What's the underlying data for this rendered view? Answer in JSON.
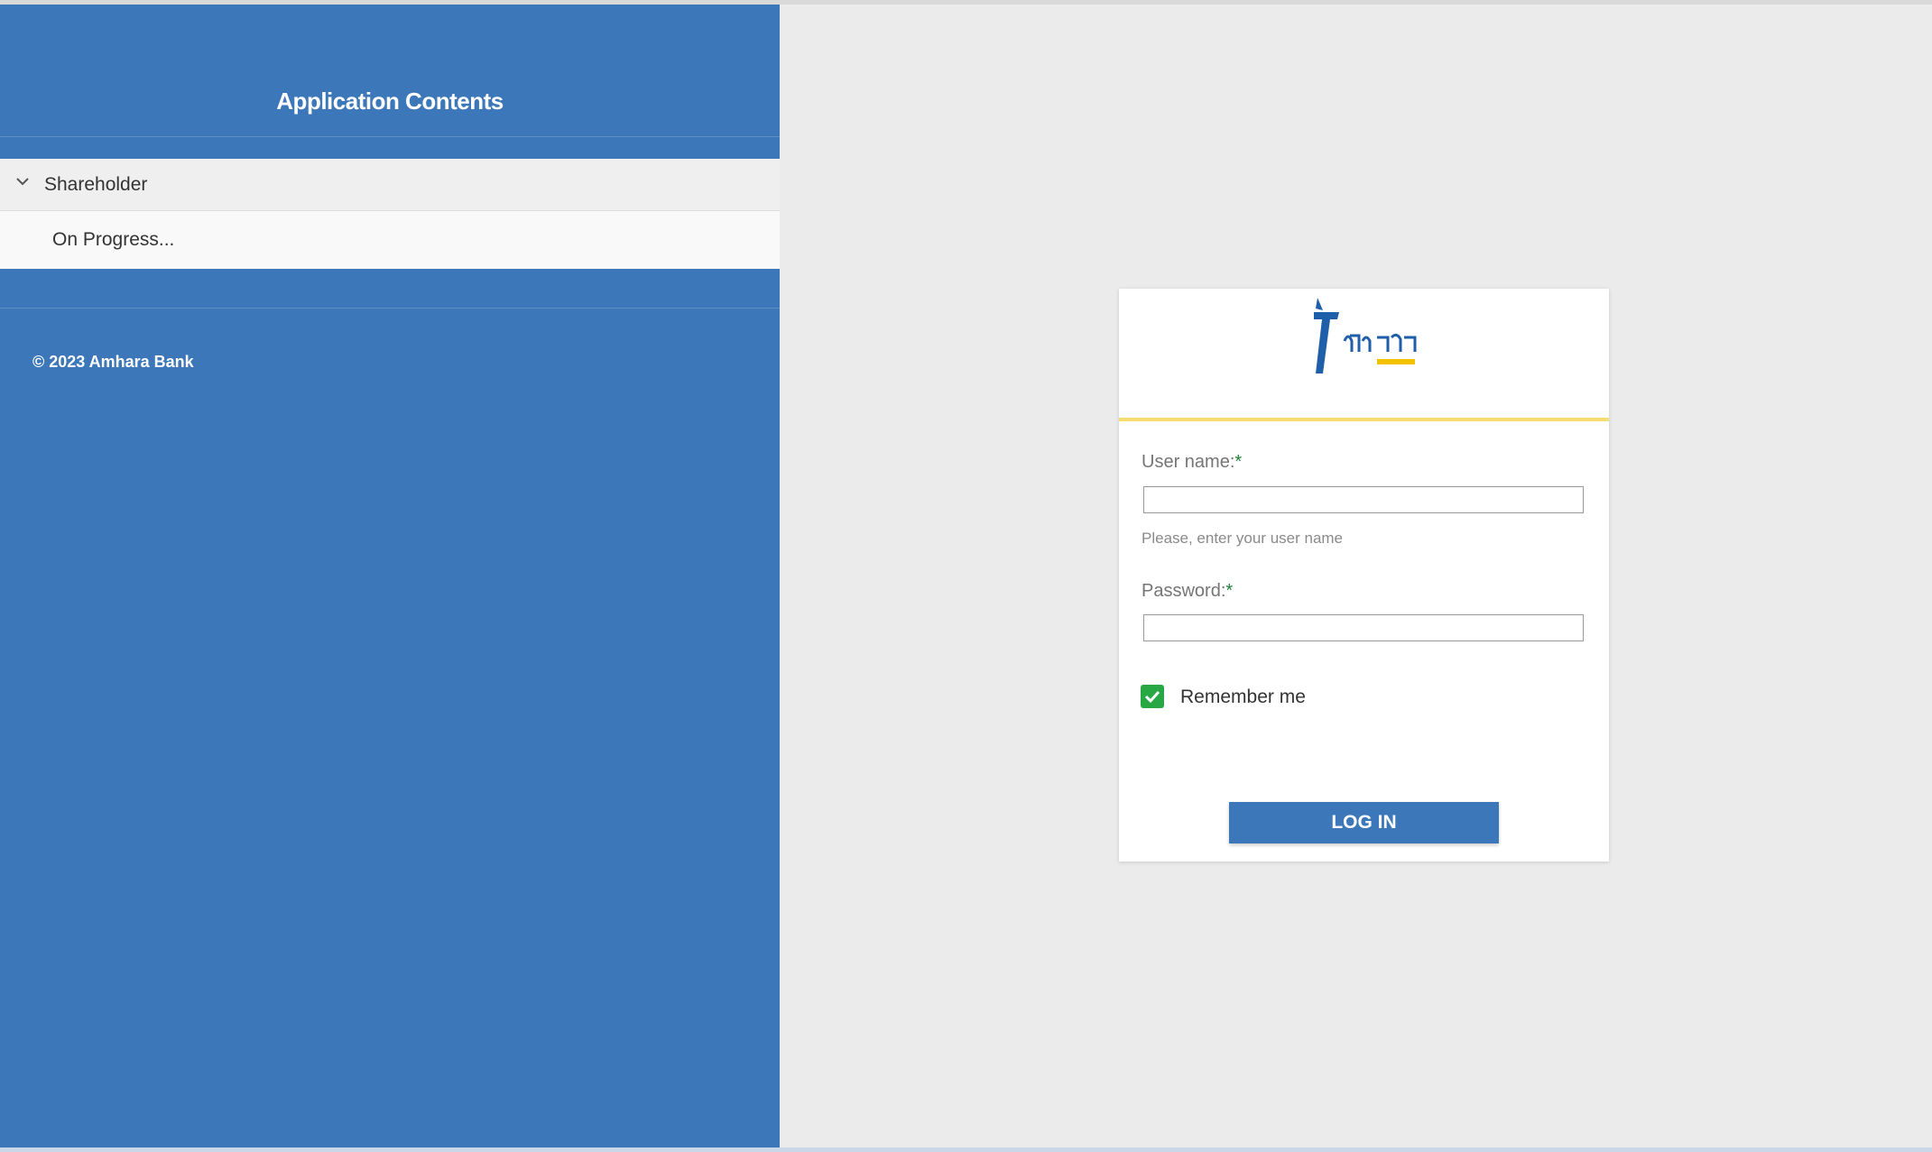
{
  "sidebar": {
    "title": "Application Contents",
    "nav_group": {
      "label": "Shareholder",
      "expanded": true,
      "items": [
        {
          "label": "On Progress..."
        }
      ]
    },
    "footer": "© 2023 Amhara Bank"
  },
  "login": {
    "logo_name": "amhara-bank-logo",
    "username": {
      "label": "User name:",
      "required_mark": "*",
      "value": "",
      "hint": "Please, enter your user name"
    },
    "password": {
      "label": "Password:",
      "required_mark": "*",
      "value": ""
    },
    "remember_me": {
      "label": "Remember me",
      "checked": true
    },
    "submit_label": "LOG IN"
  },
  "colors": {
    "sidebar_bg": "#3b77b9",
    "main_bg": "#ebebeb",
    "accent_yellow": "#f7dc6f",
    "checkbox_green": "#28a745",
    "button_blue": "#3b77b9"
  }
}
